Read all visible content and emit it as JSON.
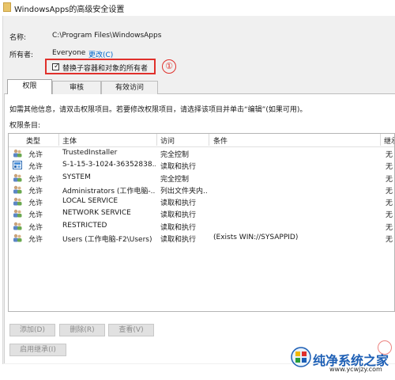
{
  "window": {
    "title": "WindowsApps的高级安全设置"
  },
  "info": {
    "name_label": "名称:",
    "name_value": "C:\\Program Files\\WindowsApps",
    "owner_label": "所有者:",
    "owner_value": "Everyone",
    "change_link": "更改(C)"
  },
  "replace_owner": {
    "label": "替换子容器和对象的所有者",
    "checked": true,
    "callout": "①"
  },
  "tabs": [
    {
      "label": "权限"
    },
    {
      "label": "审核"
    },
    {
      "label": "有效访问"
    }
  ],
  "hint_text": "如需其他信息，请双击权限项目。若要修改权限项目，请选择该项目并单击“编辑”(如果可用)。",
  "entries_label": "权限条目:",
  "columns": [
    "类型",
    "主体",
    "访问",
    "条件",
    "继承"
  ],
  "rows": [
    {
      "icon": "group-icon",
      "type": "允许",
      "principal": "TrustedInstaller",
      "access": "完全控制",
      "condition": "",
      "inherit": "无"
    },
    {
      "icon": "package-icon",
      "type": "允许",
      "principal": "S-1-15-3-1024-36352838...",
      "access": "读取和执行",
      "condition": "",
      "inherit": "无"
    },
    {
      "icon": "group-icon",
      "type": "允许",
      "principal": "SYSTEM",
      "access": "完全控制",
      "condition": "",
      "inherit": "无"
    },
    {
      "icon": "group-icon",
      "type": "允许",
      "principal": "Administrators (工作电脑-...",
      "access": "列出文件夹内...",
      "condition": "",
      "inherit": "无"
    },
    {
      "icon": "group-icon",
      "type": "允许",
      "principal": "LOCAL SERVICE",
      "access": "读取和执行",
      "condition": "",
      "inherit": "无"
    },
    {
      "icon": "group-icon",
      "type": "允许",
      "principal": "NETWORK SERVICE",
      "access": "读取和执行",
      "condition": "",
      "inherit": "无"
    },
    {
      "icon": "group-icon",
      "type": "允许",
      "principal": "RESTRICTED",
      "access": "读取和执行",
      "condition": "",
      "inherit": "无"
    },
    {
      "icon": "group-icon",
      "type": "允许",
      "principal": "Users (工作电脑-F2\\Users)",
      "access": "读取和执行",
      "condition": "(Exists WIN://SYSAPPID)",
      "inherit": "无"
    }
  ],
  "buttons": {
    "add": "添加(D)",
    "remove": "删除(R)",
    "view": "查看(V)",
    "enable_inheritance": "启用继承(I)"
  },
  "watermark": {
    "brand": "纯净系统之家",
    "url": "www.ycwjzy.com"
  },
  "colors": {
    "callout_red": "#e0302b",
    "link_blue": "#0066cc",
    "brand_blue": "#1d5fb5"
  }
}
